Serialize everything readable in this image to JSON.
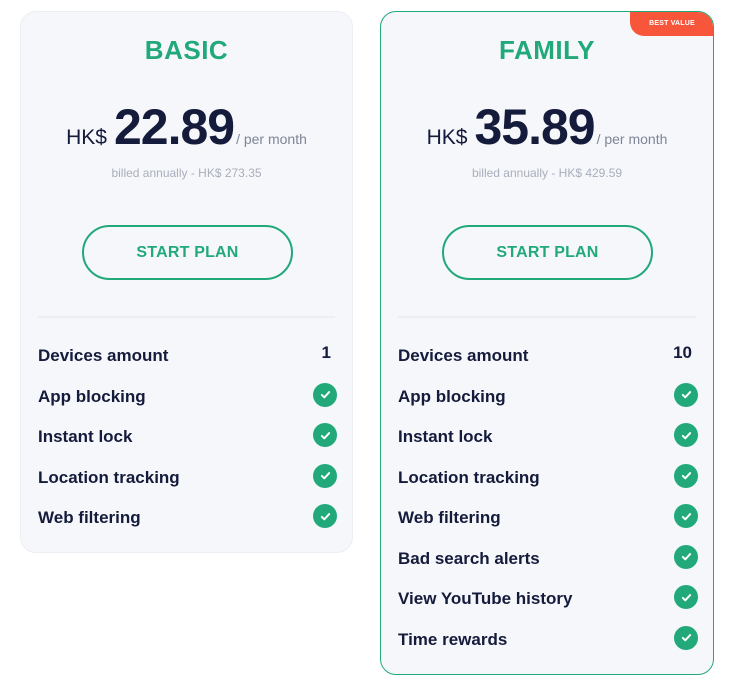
{
  "colors": {
    "accent": "#22a97a",
    "text": "#141b3b",
    "muted": "#a9aebb",
    "badge": "#f7563b",
    "card_bg": "#f6f7fb"
  },
  "plans": [
    {
      "name": "BASIC",
      "currency": "HK$",
      "amount": "22.89",
      "period": "/ per month",
      "billed": "billed annually - HK$ 273.35",
      "cta": "START PLAN",
      "features": [
        {
          "label": "Devices amount",
          "value": "1"
        },
        {
          "label": "App blocking",
          "icon": "check-circle-icon"
        },
        {
          "label": "Instant lock",
          "icon": "check-circle-icon"
        },
        {
          "label": "Location tracking",
          "icon": "check-circle-icon"
        },
        {
          "label": "Web filtering",
          "icon": "check-circle-icon"
        }
      ]
    },
    {
      "name": "FAMILY",
      "badge": "BEST VALUE",
      "currency": "HK$",
      "amount": "35.89",
      "period": "/ per month",
      "billed": "billed annually - HK$ 429.59",
      "cta": "START PLAN",
      "features": [
        {
          "label": "Devices amount",
          "value": "10"
        },
        {
          "label": "App blocking",
          "icon": "check-circle-icon"
        },
        {
          "label": "Instant lock",
          "icon": "check-circle-icon"
        },
        {
          "label": "Location tracking",
          "icon": "check-circle-icon"
        },
        {
          "label": "Web filtering",
          "icon": "check-circle-icon"
        },
        {
          "label": "Bad search alerts",
          "icon": "check-circle-icon"
        },
        {
          "label": "View YouTube history",
          "icon": "check-circle-icon"
        },
        {
          "label": "Time rewards",
          "icon": "check-circle-icon"
        }
      ]
    }
  ]
}
